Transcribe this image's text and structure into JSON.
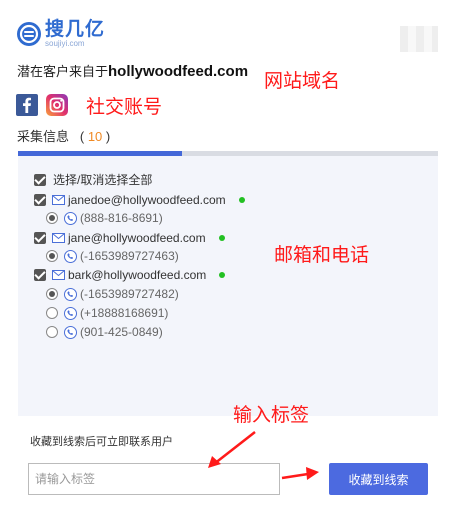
{
  "header": {
    "logo_name": "搜几亿",
    "logo_domain": "soujiyi.com"
  },
  "source": {
    "prefix": "潜在客户来自于",
    "domain": "hollywoodfeed.com"
  },
  "annotations": {
    "domain_label": "网站域名",
    "social_label": "社交账号",
    "contacts_label": "邮箱和电话",
    "tag_label": "输入标签"
  },
  "social": {
    "icons": [
      "facebook-icon",
      "instagram-icon"
    ],
    "colors": {
      "facebook": "#3b5998",
      "instagram": "#e1306c"
    }
  },
  "collected": {
    "label": "采集信息",
    "count": "10"
  },
  "contacts": {
    "select_all": "选择/取消选择全部",
    "groups": [
      {
        "email": "janedoe@hollywoodfeed.com",
        "phones": [
          "(888-816-8691)"
        ]
      },
      {
        "email": "jane@hollywoodfeed.com",
        "phones": [
          "(-1653989727463)"
        ]
      },
      {
        "email": "bark@hollywoodfeed.com",
        "phones": [
          "(-1653989727482)",
          "(+18888168691)",
          "(901-425-0849)"
        ]
      }
    ]
  },
  "footer": {
    "hint": "收藏到线索后可立即联系用户",
    "tag_placeholder": "请输入标签",
    "save_label": "收藏到线索"
  },
  "colors": {
    "accent": "#4c6ae0",
    "tab_active": "#4468d8",
    "annotation": "#ff1a1a",
    "status_dot": "#22c022",
    "count": "#f08a24"
  }
}
